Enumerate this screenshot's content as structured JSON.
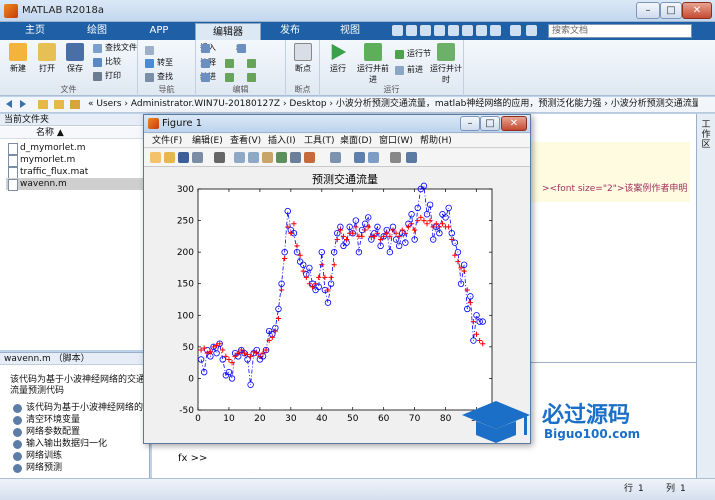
{
  "window": {
    "title": "MATLAB R2018a",
    "min": "–",
    "max": "□",
    "close": "✕"
  },
  "tabs": [
    {
      "label": "主页",
      "active": false
    },
    {
      "label": "绘图",
      "active": false
    },
    {
      "label": "APP",
      "active": false
    },
    {
      "label": "编辑器",
      "active": true
    },
    {
      "label": "发布",
      "active": false
    },
    {
      "label": "视图",
      "active": false
    }
  ],
  "search": {
    "placeholder": "搜索文档"
  },
  "ribbon": {
    "file": {
      "group": "文件",
      "new": "新建",
      "open": "打开",
      "save": "保存",
      "find_files": "查找文件",
      "compare": "比较",
      "print": "打印"
    },
    "navigate": {
      "group": "导航",
      "goto": "转至",
      "find": "查找"
    },
    "edit": {
      "group": "编辑",
      "insert": "插入",
      "comment": "注释",
      "indent": "缩进",
      "fx": "fx"
    },
    "breakpoints": {
      "group": "断点",
      "label": "断点"
    },
    "run": {
      "group": "运行",
      "run": "运行",
      "run_advance": "运行并前进",
      "run_section": "运行节",
      "advance": "前进",
      "run_time": "运行并计时"
    }
  },
  "addressbar": {
    "path": "« Users › Administrator.WIN7U-20180127Z › Desktop › 小波分析预测交通流量，matlab神经网络的应用，预测泛化能力强 › 小波分析预测交通流量"
  },
  "current_folder": {
    "title": "当前文件夹",
    "column": "名称 ▲",
    "files": [
      {
        "name": "d_mymorlet.m",
        "selected": false
      },
      {
        "name": "mymorlet.m",
        "selected": false
      },
      {
        "name": "traffic_flux.mat",
        "selected": false
      },
      {
        "name": "wavenn.m",
        "selected": true
      }
    ]
  },
  "details": {
    "header": "wavenn.m （脚本）",
    "description": "该代码为基于小波神经网络的交通流量预测代码",
    "items": [
      "该代码为基于小波神经网络的交…",
      "清空环境变量",
      "网络参数配置",
      "输入输出数据归一化",
      "网络训练",
      "网络预测"
    ]
  },
  "editor": {
    "code_snippet": "><font size=\"2\">该案例作者申明",
    "side_tab": "工作区"
  },
  "command": {
    "prompt": "fx >>"
  },
  "status": {
    "line_label": "行",
    "line": "1",
    "col_label": "列",
    "col": "1"
  },
  "figure": {
    "title": "Figure 1",
    "menu": [
      "文件(F)",
      "编辑(E)",
      "查看(V)",
      "插入(I)",
      "工具(T)",
      "桌面(D)",
      "窗口(W)",
      "帮助(H)"
    ]
  },
  "watermark": {
    "main": "必过源码",
    "sub": "Biguo100.com"
  },
  "chart_data": {
    "type": "line",
    "title": "预测交通流量",
    "xlabel": "",
    "ylabel": "",
    "xlim": [
      0,
      95
    ],
    "ylim": [
      -50,
      300
    ],
    "xticks": [
      0,
      10,
      20,
      30,
      40,
      50,
      60,
      70,
      80,
      90
    ],
    "yticks": [
      -50,
      0,
      50,
      100,
      150,
      200,
      250,
      300
    ],
    "grid": false,
    "series": [
      {
        "name": "",
        "style": "dash-dot with circle markers",
        "color": "#0000ff",
        "x": [
          1,
          2,
          3,
          4,
          5,
          6,
          7,
          8,
          9,
          10,
          11,
          12,
          13,
          14,
          15,
          16,
          17,
          18,
          19,
          20,
          21,
          22,
          23,
          24,
          25,
          26,
          27,
          28,
          29,
          30,
          31,
          32,
          33,
          34,
          35,
          36,
          37,
          38,
          39,
          40,
          41,
          42,
          43,
          44,
          45,
          46,
          47,
          48,
          49,
          50,
          51,
          52,
          53,
          54,
          55,
          56,
          57,
          58,
          59,
          60,
          61,
          62,
          63,
          64,
          65,
          66,
          67,
          68,
          69,
          70,
          71,
          72,
          73,
          74,
          75,
          76,
          77,
          78,
          79,
          80,
          81,
          82,
          83,
          84,
          85,
          86,
          87,
          88,
          89,
          90,
          91,
          92
        ],
        "values": [
          30,
          10,
          45,
          35,
          50,
          40,
          55,
          30,
          5,
          10,
          0,
          40,
          35,
          45,
          40,
          30,
          -10,
          40,
          45,
          30,
          35,
          45,
          75,
          70,
          80,
          110,
          150,
          200,
          265,
          235,
          230,
          200,
          185,
          180,
          165,
          175,
          150,
          140,
          145,
          200,
          140,
          120,
          150,
          200,
          230,
          240,
          210,
          215,
          240,
          230,
          250,
          200,
          235,
          245,
          255,
          220,
          230,
          240,
          210,
          225,
          235,
          200,
          240,
          220,
          210,
          230,
          215,
          245,
          260,
          220,
          270,
          300,
          305,
          260,
          275,
          220,
          240,
          230,
          260,
          255,
          270,
          230,
          215,
          200,
          150,
          180,
          110,
          130,
          60,
          100,
          90,
          90
        ],
        "markers": "o"
      },
      {
        "name": "",
        "style": "red plus markers",
        "color": "#ff0000",
        "x": [
          1,
          2,
          3,
          4,
          5,
          6,
          7,
          8,
          9,
          10,
          11,
          12,
          13,
          14,
          15,
          16,
          17,
          18,
          19,
          20,
          21,
          22,
          23,
          24,
          25,
          26,
          27,
          28,
          29,
          30,
          31,
          32,
          33,
          34,
          35,
          36,
          37,
          38,
          39,
          40,
          41,
          42,
          43,
          44,
          45,
          46,
          47,
          48,
          49,
          50,
          51,
          52,
          53,
          54,
          55,
          56,
          57,
          58,
          59,
          60,
          61,
          62,
          63,
          64,
          65,
          66,
          67,
          68,
          69,
          70,
          71,
          72,
          73,
          74,
          75,
          76,
          77,
          78,
          79,
          80,
          81,
          82,
          83,
          84,
          85,
          86,
          87,
          88,
          89,
          90,
          91,
          92
        ],
        "values": [
          45,
          48,
          40,
          42,
          50,
          52,
          55,
          45,
          35,
          30,
          25,
          35,
          40,
          45,
          40,
          38,
          35,
          42,
          40,
          35,
          40,
          45,
          60,
          65,
          75,
          95,
          140,
          190,
          240,
          230,
          245,
          210,
          195,
          170,
          160,
          150,
          145,
          150,
          160,
          180,
          160,
          140,
          160,
          180,
          220,
          235,
          225,
          220,
          230,
          230,
          240,
          225,
          225,
          235,
          240,
          225,
          225,
          230,
          220,
          225,
          230,
          225,
          235,
          230,
          225,
          235,
          230,
          240,
          245,
          235,
          250,
          255,
          250,
          245,
          250,
          240,
          245,
          240,
          245,
          240,
          240,
          220,
          195,
          185,
          175,
          170,
          140,
          120,
          90,
          70,
          60,
          55
        ],
        "markers": "+"
      }
    ]
  }
}
